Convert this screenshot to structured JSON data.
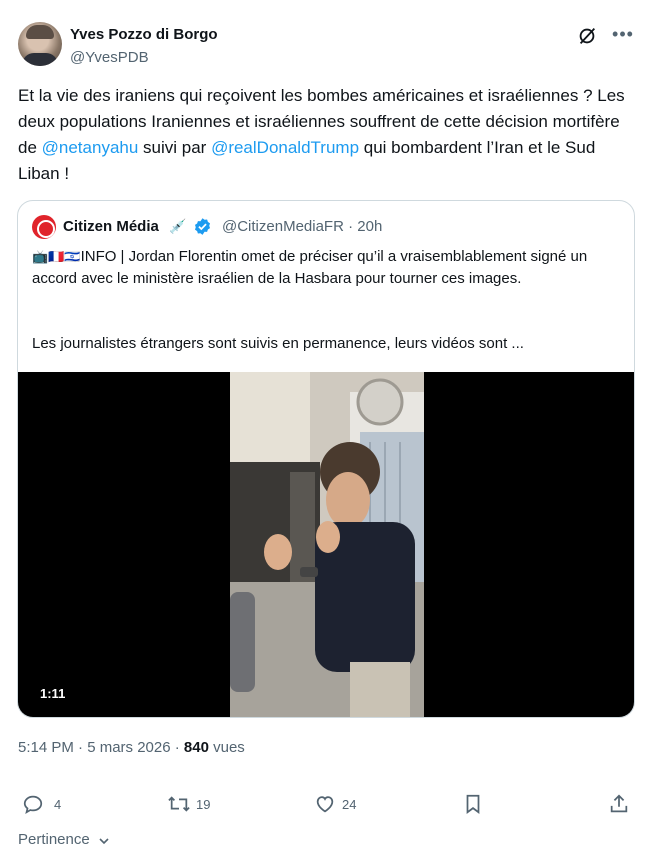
{
  "author": {
    "name": "Yves Pozzo di Borgo",
    "handle": "@YvesPDB"
  },
  "tweet": {
    "part1": "Et la vie des iraniens qui reçoivent les bombes américaines et israéliennes ? Les deux populations Iraniennes et israéliennes souffrent de cette décision mortifère de ",
    "mention1": "@netanyahu",
    "part2": " suivi par ",
    "mention2": "@realDonaldTrump",
    "part3": " qui bombardent l’Iran et le Sud Liban !"
  },
  "quote": {
    "name": "Citizen Média",
    "emoji": "💉",
    "handle_time": "@CitizenMediaFR · 20h",
    "flags": "📺🇫🇷🇮🇱",
    "text": "INFO | Jordan Florentin omet de préciser qu’il a vraisemblablement signé un accord avec le ministère israélien de la Hasbara pour tourner ces images.",
    "text2": "Les journalistes étrangers sont suivis en permanence, leurs vidéos sont ...",
    "video_duration": "1:11"
  },
  "meta": {
    "datetime": "5:14 PM · 5 mars 2026 · ",
    "views_count": "840",
    "views_label": " vues"
  },
  "actions": {
    "replies": "4",
    "reposts": "19",
    "likes": "24"
  },
  "sort": {
    "label": "Pertinence"
  },
  "colors": {
    "accent": "#1d9bf0",
    "text": "#0f1419",
    "muted": "#536471",
    "border": "#cfd9de"
  }
}
